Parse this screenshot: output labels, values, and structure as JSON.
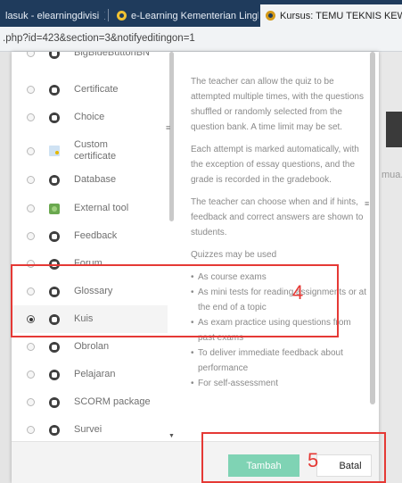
{
  "browser": {
    "tabs": [
      {
        "label": "lasuk - elearningdivisi",
        "close": "X"
      },
      {
        "label": "e-Learning Kementerian Lingk",
        "close": "X"
      },
      {
        "label": "Kursus: TEMU TEKNIS KEWIRAU",
        "close": "X"
      }
    ],
    "url": ".php?id=423&section=3&notifyeditingon=1"
  },
  "background": {
    "fragment_right": "mua."
  },
  "activity_chooser": {
    "items": [
      {
        "label": "BigBlueButtonBN",
        "icon": "bigbluebutton-icon",
        "selected": false
      },
      {
        "label": "Certificate",
        "icon": "certificate-icon",
        "selected": false
      },
      {
        "label": "Choice",
        "icon": "choice-icon",
        "selected": false
      },
      {
        "label": "Custom certificate",
        "icon": "custom-certificate-icon",
        "selected": false
      },
      {
        "label": "Database",
        "icon": "database-icon",
        "selected": false
      },
      {
        "label": "External tool",
        "icon": "puzzle-icon",
        "selected": false
      },
      {
        "label": "Feedback",
        "icon": "feedback-icon",
        "selected": false
      },
      {
        "label": "Forum",
        "icon": "forum-icon",
        "selected": false
      },
      {
        "label": "Glossary",
        "icon": "glossary-icon",
        "selected": false
      },
      {
        "label": "Kuis",
        "icon": "quiz-icon",
        "selected": true
      },
      {
        "label": "Obrolan",
        "icon": "chat-icon",
        "selected": false
      },
      {
        "label": "Pelajaran",
        "icon": "lesson-icon",
        "selected": false
      },
      {
        "label": "SCORM package",
        "icon": "scorm-icon",
        "selected": false
      },
      {
        "label": "Survei",
        "icon": "survey-icon",
        "selected": false
      }
    ],
    "description": {
      "paragraphs": [
        "The teacher can allow the quiz to be attempted multiple times, with the questions shuffled or randomly selected from the question bank. A time limit may be set.",
        "Each attempt is marked automatically, with the exception of essay questions, and the grade is recorded in the gradebook.",
        "The teacher can choose when and if hints, feedback and correct answers are shown to students.",
        "Quizzes may be used"
      ],
      "bullets": [
        "As course exams",
        "As mini tests for reading assignments or at the end of a topic",
        "As exam practice using questions from past exams",
        "To deliver immediate feedback about performance",
        "For self-assessment"
      ]
    },
    "buttons": {
      "add": "Tambah",
      "cancel": "Batal"
    }
  },
  "annotations": [
    {
      "number": "4",
      "color": "#e53935"
    },
    {
      "number": "5",
      "color": "#e53935"
    }
  ]
}
